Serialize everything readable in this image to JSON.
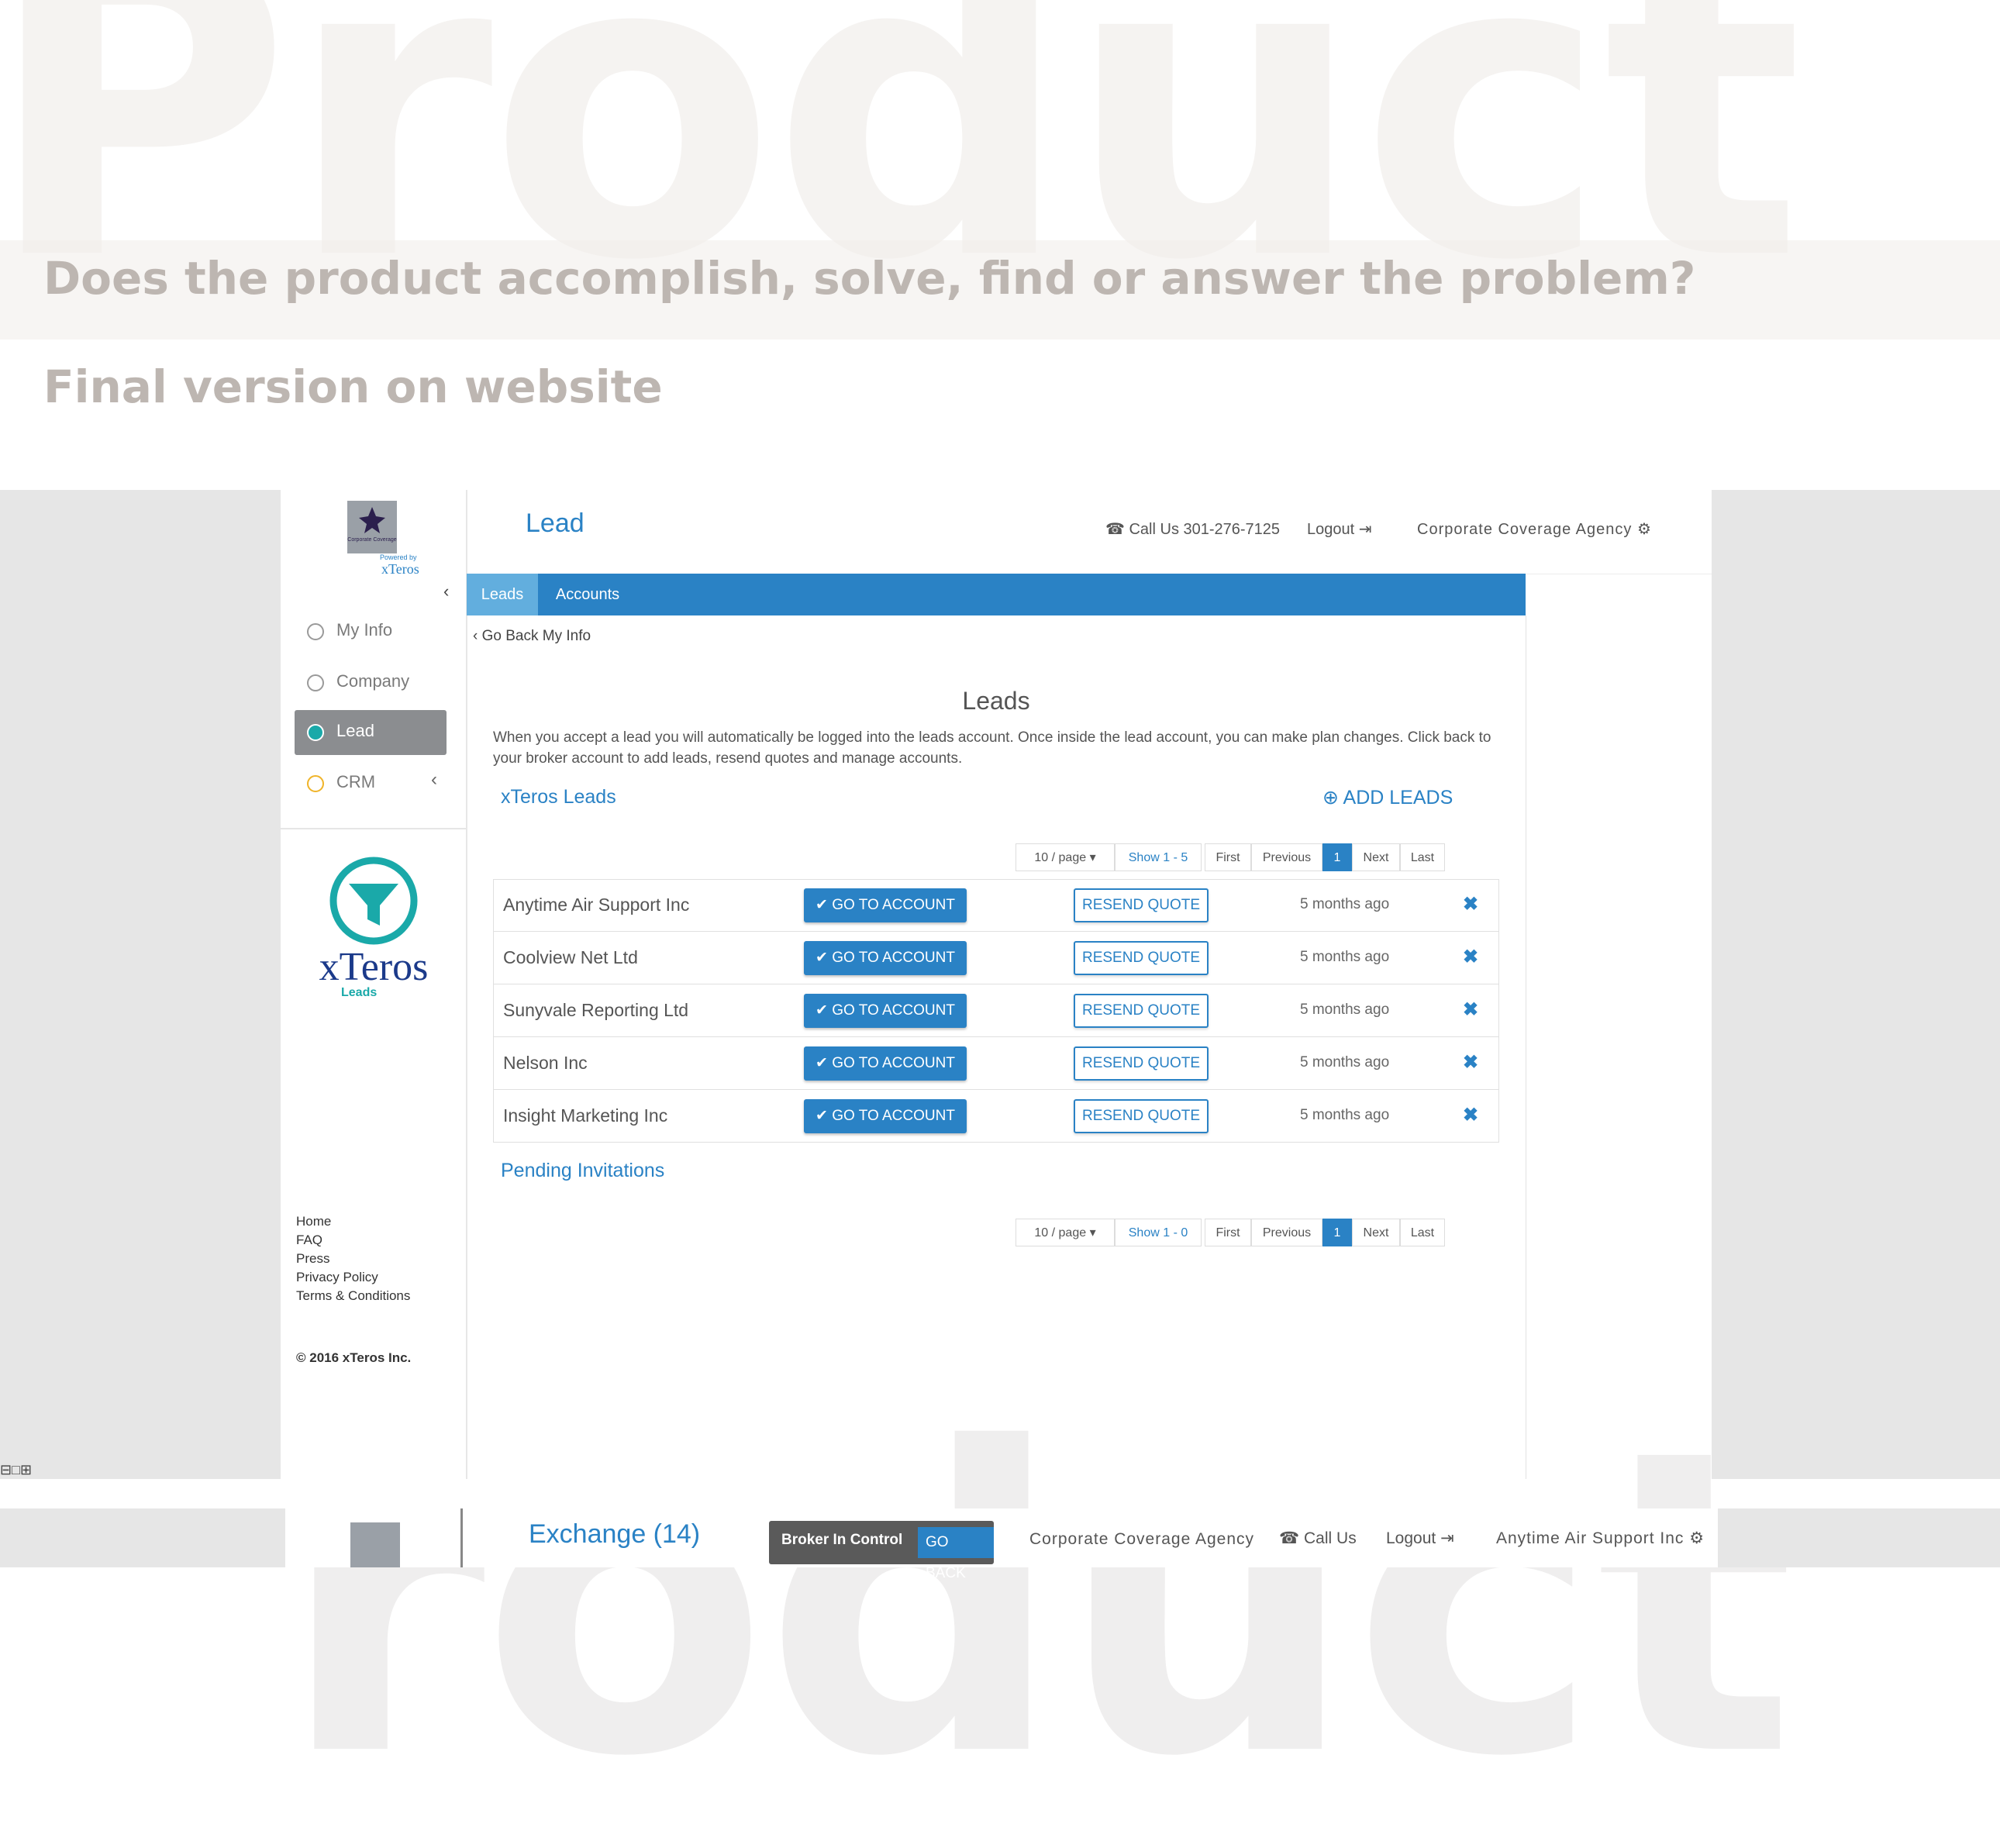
{
  "slide": {
    "background_word": "Product",
    "question": "Does the product accomplish, solve, find or answer the problem?",
    "subtitle": "Final version on website"
  },
  "sidebar": {
    "logo_caption_top": "Corporate Coverage",
    "logo_powered": "Powered by",
    "logo_brand": "xTeros",
    "items": [
      {
        "label": "My Info",
        "icon": "user-icon"
      },
      {
        "label": "Company",
        "icon": "building-icon"
      },
      {
        "label": "Lead",
        "icon": "funnel-icon",
        "active": true
      },
      {
        "label": "CRM",
        "icon": "crm-icon"
      }
    ],
    "big_logo_brand": "xTeros",
    "big_logo_sub": "Leads",
    "footer_links": [
      "Home",
      "FAQ",
      "Press",
      "Privacy Policy",
      "Terms & Conditions"
    ],
    "copyright": "© 2016 xTeros Inc."
  },
  "header": {
    "title": "Lead",
    "call": "Call Us 301-276-7125",
    "logout": "Logout",
    "agency": "Corporate Coverage Agency"
  },
  "tabs": [
    "Leads",
    "Accounts"
  ],
  "content": {
    "back_link": "Go Back My Info",
    "heading": "Leads",
    "description": "When you accept a lead you will automatically be logged into the leads account. Once inside the lead account, you can make plan changes. Click back to your broker account to add leads, resend quotes and manage accounts.",
    "section_title": "xTeros Leads",
    "add_leads": "ADD LEADS",
    "pager_top": {
      "per_page": "10 / page",
      "show": "Show 1 - 5",
      "first": "First",
      "previous": "Previous",
      "page": "1",
      "next": "Next",
      "last": "Last"
    },
    "go_label": "GO TO ACCOUNT",
    "resend_label": "RESEND QUOTE",
    "leads": [
      {
        "name": "Anytime Air Support Inc",
        "time": "5 months ago"
      },
      {
        "name": "Coolview Net Ltd",
        "time": "5 months ago"
      },
      {
        "name": "Sunyvale Reporting Ltd",
        "time": "5 months ago"
      },
      {
        "name": "Nelson Inc",
        "time": "5 months ago"
      },
      {
        "name": "Insight Marketing Inc",
        "time": "5 months ago"
      }
    ],
    "pending_title": "Pending Invitations",
    "pager_bottom": {
      "per_page": "10 / page",
      "show": "Show 1 - 0",
      "first": "First",
      "previous": "Previous",
      "page": "1",
      "next": "Next",
      "last": "Last"
    }
  },
  "bottom_preview": {
    "title": "Exchange (14)",
    "broker": "Broker In Control",
    "go_back": "GO BACK",
    "agency": "Corporate Coverage Agency",
    "call": "Call Us",
    "logout": "Logout",
    "account": "Anytime Air Support Inc"
  },
  "colors": {
    "accent": "#2a82c5",
    "active_nav": "#8b8d90",
    "teal": "#1aa9a9"
  }
}
